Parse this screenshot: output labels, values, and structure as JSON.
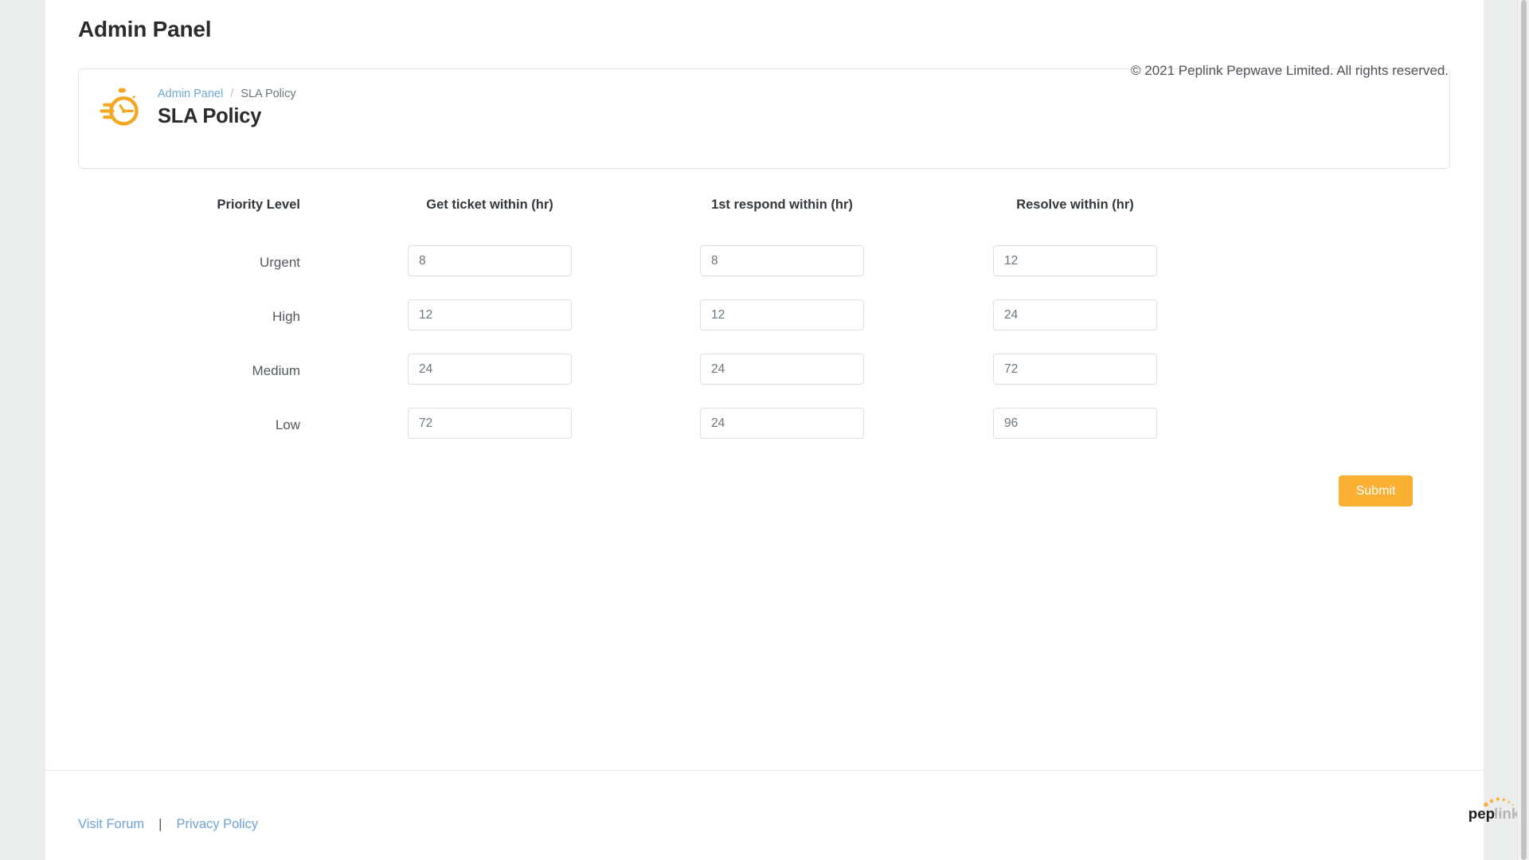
{
  "page": {
    "title": "Admin Panel"
  },
  "breadcrumb": {
    "icon": "stopwatch-icon",
    "parent": "Admin Panel",
    "separator": "/",
    "current": "SLA Policy",
    "heading": "SLA Policy"
  },
  "table": {
    "headers": {
      "priority": "Priority Level",
      "get_ticket": "Get ticket within (hr)",
      "first_respond": "1st respond within (hr)",
      "resolve": "Resolve within (hr)"
    },
    "rows": [
      {
        "priority": "Urgent",
        "get_ticket": "8",
        "first_respond": "8",
        "resolve": "12"
      },
      {
        "priority": "High",
        "get_ticket": "12",
        "first_respond": "12",
        "resolve": "24"
      },
      {
        "priority": "Medium",
        "get_ticket": "24",
        "first_respond": "24",
        "resolve": "72"
      },
      {
        "priority": "Low",
        "get_ticket": "72",
        "first_respond": "24",
        "resolve": "96"
      }
    ]
  },
  "actions": {
    "submit_label": "Submit"
  },
  "footer": {
    "visit_forum": "Visit Forum",
    "divider": "|",
    "privacy_policy": "Privacy Policy",
    "copyright": "© 2021 Peplink Pepwave Limited. All rights reserved.",
    "logo": {
      "text_bold": "pep",
      "text_light": "link",
      "name": "peplink-logo"
    }
  },
  "colors": {
    "accent_orange": "#fbb034",
    "link_blue": "#6da3d6",
    "text_dark": "#2b2b2b",
    "text_muted": "#6c757d",
    "border_gray": "#dcdfe2",
    "page_bg": "#eceded"
  }
}
